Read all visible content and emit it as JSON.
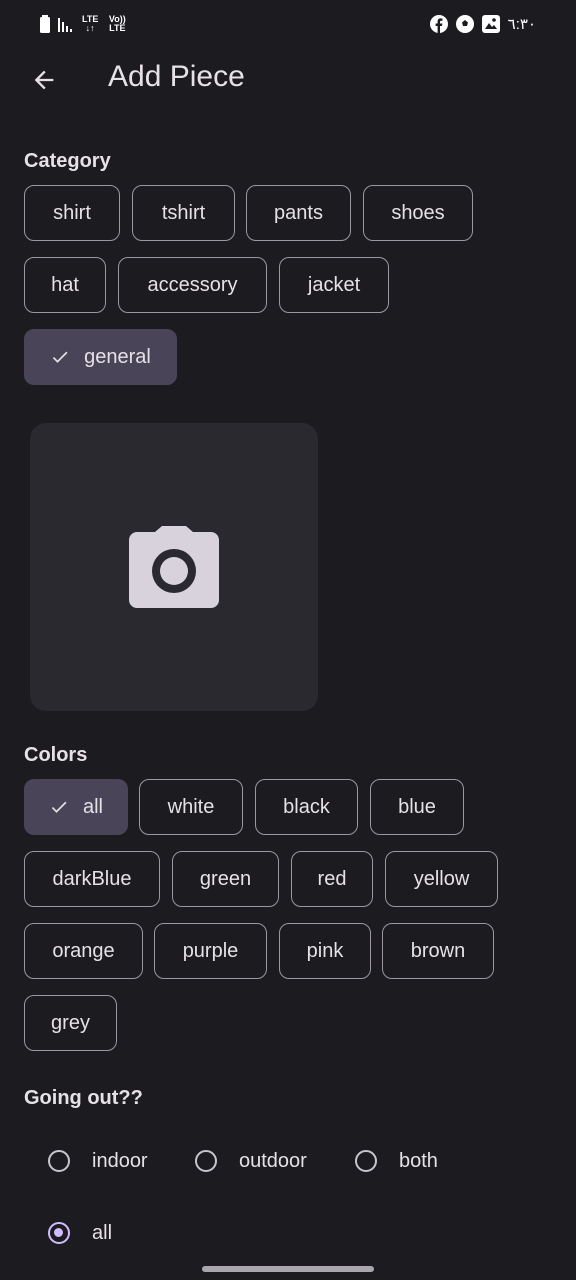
{
  "status": {
    "time": "٦:٣٠",
    "network_top": "LTE",
    "network_bottom": "Vo)) LTE"
  },
  "header": {
    "title": "Add Piece"
  },
  "category": {
    "label": "Category",
    "chips": [
      {
        "label": "shirt",
        "selected": false
      },
      {
        "label": "tshirt",
        "selected": false
      },
      {
        "label": "pants",
        "selected": false
      },
      {
        "label": "shoes",
        "selected": false
      },
      {
        "label": "hat",
        "selected": false
      },
      {
        "label": "accessory",
        "selected": false
      },
      {
        "label": "jacket",
        "selected": false
      },
      {
        "label": "general",
        "selected": true
      }
    ]
  },
  "photo": {
    "icon": "camera-icon"
  },
  "colors": {
    "label": "Colors",
    "chips": [
      {
        "label": "all",
        "selected": true
      },
      {
        "label": "white",
        "selected": false
      },
      {
        "label": "black",
        "selected": false
      },
      {
        "label": "blue",
        "selected": false
      },
      {
        "label": "darkBlue",
        "selected": false
      },
      {
        "label": "green",
        "selected": false
      },
      {
        "label": "red",
        "selected": false
      },
      {
        "label": "yellow",
        "selected": false
      },
      {
        "label": "orange",
        "selected": false
      },
      {
        "label": "purple",
        "selected": false
      },
      {
        "label": "pink",
        "selected": false
      },
      {
        "label": "brown",
        "selected": false
      },
      {
        "label": "grey",
        "selected": false
      }
    ]
  },
  "going_out": {
    "label": "Going out??",
    "options": [
      {
        "label": "indoor",
        "selected": false
      },
      {
        "label": "outdoor",
        "selected": false
      },
      {
        "label": "both",
        "selected": false
      },
      {
        "label": "all",
        "selected": true
      }
    ]
  },
  "theme": {
    "background": "#1c1b20",
    "selected_chip": "#4a4458",
    "accent": "#d0bcff"
  }
}
